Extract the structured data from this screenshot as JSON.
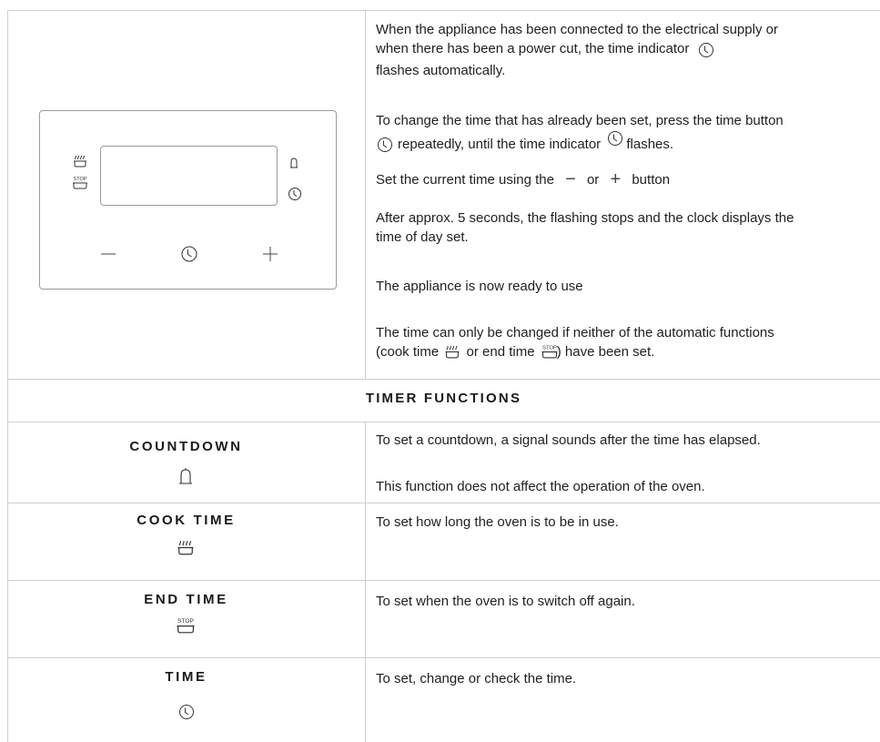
{
  "intro": {
    "p1_a": "When the appliance has been connected to the electrical supply or",
    "p1_b": "when there has been a power cut, the time indicator",
    "p1_c": "flashes automatically.",
    "p2_a": "To change the time that has already been set, press the time button",
    "p2_b": "repeatedly, until the time indicator",
    "p2_c": "flashes.",
    "p3_a": "Set the current time using the",
    "p3_minus": "−",
    "p3_or": "or",
    "p3_plus": "+",
    "p3_b": "button",
    "p4_a": "After approx. 5 seconds, the flashing stops and the clock displays the",
    "p4_b": "time of day set.",
    "p5": "The appliance is now ready to use",
    "p6_a": "The time can only be changed if neither of the automatic functions",
    "p6_b": "(cook time",
    "p6_c": "or end time",
    "p6_d": ") have been set."
  },
  "panel": {
    "minus_label": "−",
    "plus_label": "+",
    "stop_label": "STOP"
  },
  "section_title": "TIMER FUNCTIONS",
  "functions": [
    {
      "name": "COUNTDOWN",
      "icon": "bell-icon",
      "desc1": "To set a countdown, a signal sounds after the time has elapsed.",
      "desc2": "This function does not affect the operation of the oven."
    },
    {
      "name": "COOK TIME",
      "icon": "cook-time-icon",
      "desc1": "To set how long the oven is to be in use."
    },
    {
      "name": "END TIME",
      "icon": "end-time-icon",
      "desc1": "To set when the oven is to switch off again."
    },
    {
      "name": "TIME",
      "icon": "clock-icon",
      "desc1": "To set, change or check the time."
    }
  ],
  "colors": {
    "line": "#cfcfcf",
    "panel_border": "#9a9a9a",
    "text": "#1f1f1f"
  }
}
